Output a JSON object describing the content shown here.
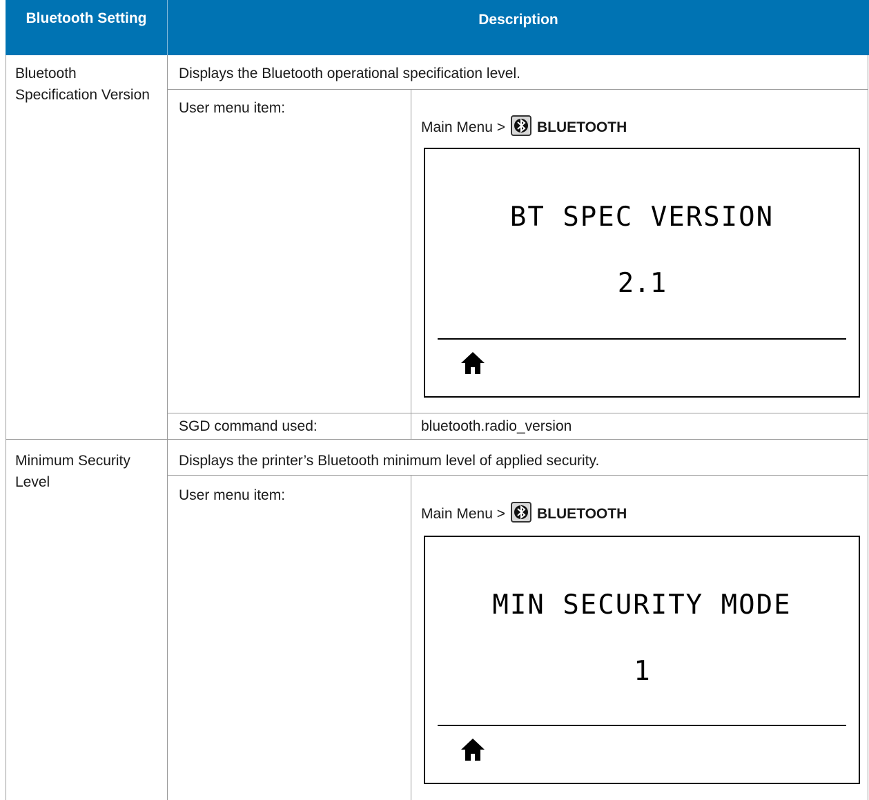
{
  "table": {
    "headers": {
      "col1": "Bluetooth Setting",
      "col2": "Description"
    },
    "rows": [
      {
        "setting": "Bluetooth Specification Version",
        "description": "Displays the Bluetooth operational specification level.",
        "user_menu_label": "User menu item:",
        "menu_path_prefix": "Main Menu >",
        "menu_path_item": "BLUETOOTH",
        "lcd_title": "BT SPEC VERSION",
        "lcd_value": "2.1",
        "sgd_label": "SGD command used:",
        "sgd_value": "bluetooth.radio_version"
      },
      {
        "setting": "Minimum Security Level",
        "description": "Displays the printer’s Bluetooth minimum level of applied security.",
        "user_menu_label": "User menu item:",
        "menu_path_prefix": "Main Menu >",
        "menu_path_item": "BLUETOOTH",
        "lcd_title": "MIN SECURITY MODE",
        "lcd_value": "1"
      }
    ]
  },
  "icons": {
    "menu_icon": "bluetooth-icon",
    "lcd_icon": "home-icon"
  },
  "colors": {
    "header_bg": "#0073b3",
    "header_text": "#ffffff"
  }
}
